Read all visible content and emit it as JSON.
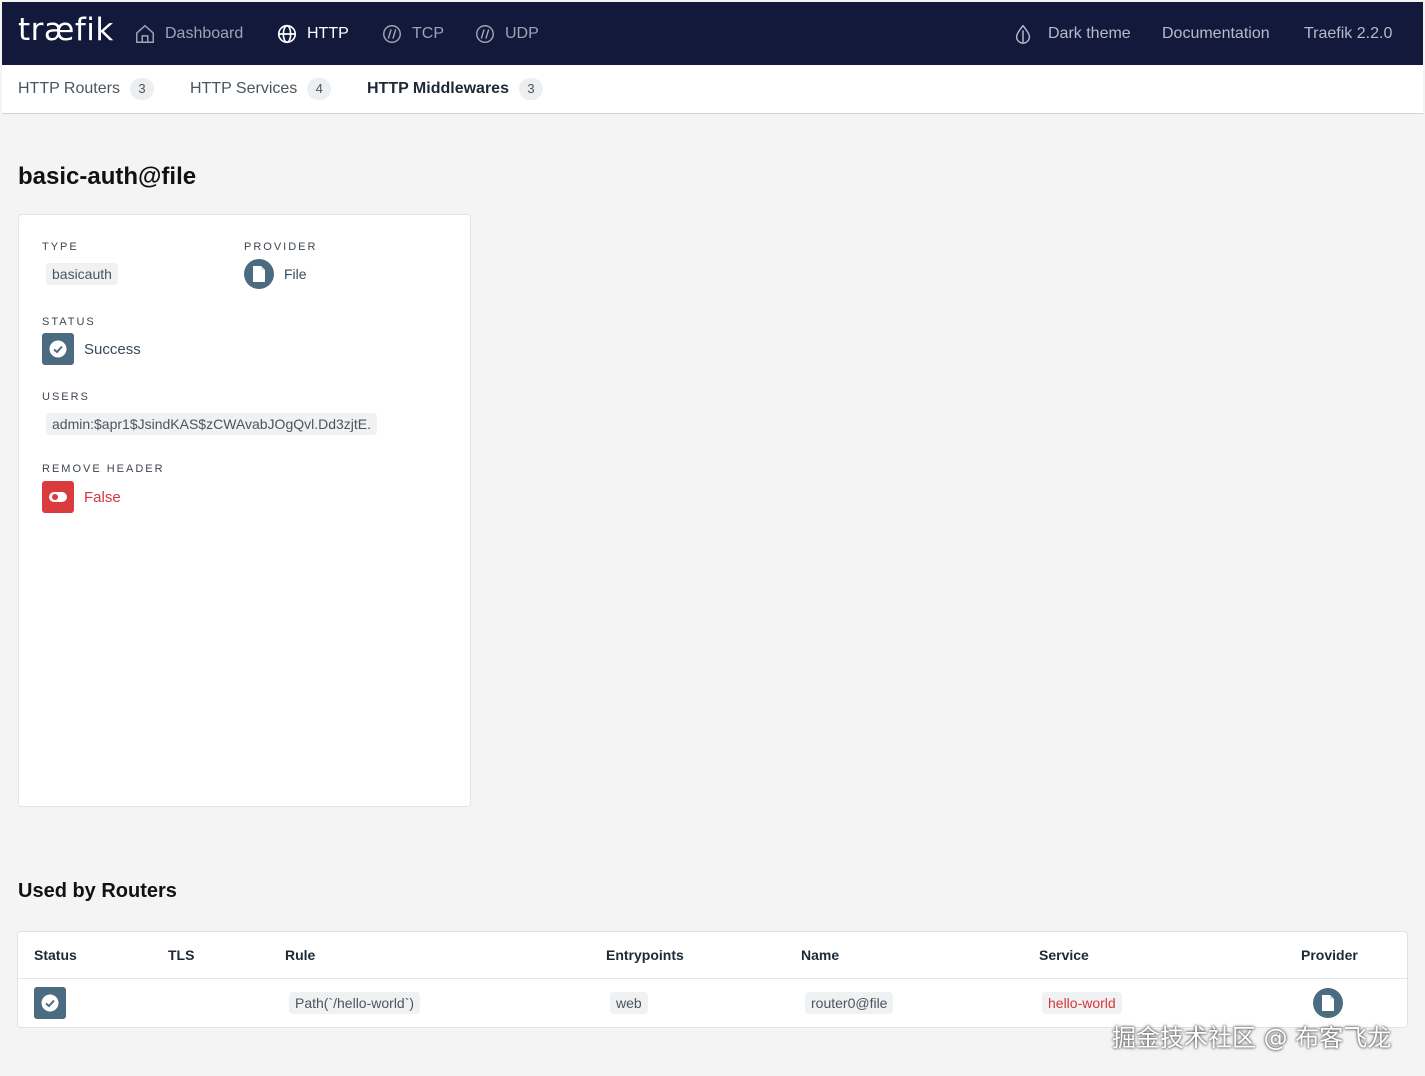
{
  "nav": {
    "logo": "træfik",
    "items": [
      {
        "label": "Dashboard",
        "icon": "home-icon"
      },
      {
        "label": "HTTP",
        "icon": "globe-icon"
      },
      {
        "label": "TCP",
        "icon": "tcp-icon"
      },
      {
        "label": "UDP",
        "icon": "udp-icon"
      }
    ],
    "dark_theme": "Dark theme",
    "documentation": "Documentation",
    "version": "Traefik 2.2.0"
  },
  "subnav": {
    "tabs": [
      {
        "label": "HTTP Routers",
        "count": "3"
      },
      {
        "label": "HTTP Services",
        "count": "4"
      },
      {
        "label": "HTTP Middlewares",
        "count": "3"
      }
    ]
  },
  "middleware": {
    "title": "basic-auth@file",
    "type_label": "TYPE",
    "type_value": "basicauth",
    "provider_label": "PROVIDER",
    "provider_value": "File",
    "status_label": "STATUS",
    "status_value": "Success",
    "users_label": "USERS",
    "users_value": "admin:$apr1$JsindKAS$zCWAvabJOgQvl.Dd3zjtE.",
    "remove_header_label": "REMOVE HEADER",
    "remove_header_value": "False"
  },
  "routers": {
    "title": "Used by Routers",
    "columns": [
      "Status",
      "TLS",
      "Rule",
      "Entrypoints",
      "Name",
      "Service",
      "Provider"
    ],
    "rows": [
      {
        "rule": "Path(`/hello-world`)",
        "entrypoints": "web",
        "name": "router0@file",
        "service": "hello-world"
      }
    ]
  },
  "watermark": "掘金技术社区 @ 布客飞龙",
  "colors": {
    "nav_bg": "#12193a",
    "success": "#4b6b80",
    "danger": "#db3a3f"
  }
}
